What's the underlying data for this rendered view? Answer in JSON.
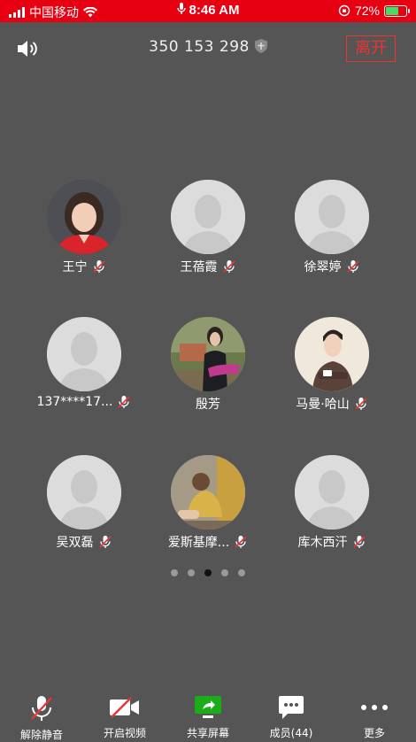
{
  "status_bar": {
    "carrier": "中国移动",
    "time": "8:46 AM",
    "battery": "72%",
    "battery_level": 0.72
  },
  "header": {
    "meeting_id": "350 153 298",
    "leave_label": "离开"
  },
  "participants": [
    {
      "name": "王宁",
      "avatar": "photo-woman-red",
      "muted": true
    },
    {
      "name": "王蓓霞",
      "avatar": "default",
      "muted": true
    },
    {
      "name": "徐翠婷",
      "avatar": "default",
      "muted": true
    },
    {
      "name": "137****17...",
      "avatar": "default",
      "muted": true
    },
    {
      "name": "殷芳",
      "avatar": "photo-woman-outdoor",
      "muted": false
    },
    {
      "name": "马曼·哈山",
      "avatar": "illustration-man",
      "muted": true
    },
    {
      "name": "吴双磊",
      "avatar": "default",
      "muted": true
    },
    {
      "name": "爱斯基摩...",
      "avatar": "photo-child",
      "muted": true
    },
    {
      "name": "库木西汗",
      "avatar": "default",
      "muted": true
    }
  ],
  "pagination": {
    "total": 5,
    "active": 2
  },
  "toolbar": {
    "unmute_label": "解除静音",
    "video_label": "开启视频",
    "share_label": "共享屏幕",
    "members_label": "成员(44)",
    "more_label": "更多"
  },
  "colors": {
    "status_bar": "#e60012",
    "background": "#555555",
    "leave": "#e33333",
    "share_green": "#1aad19",
    "muted_red": "#e33333"
  }
}
